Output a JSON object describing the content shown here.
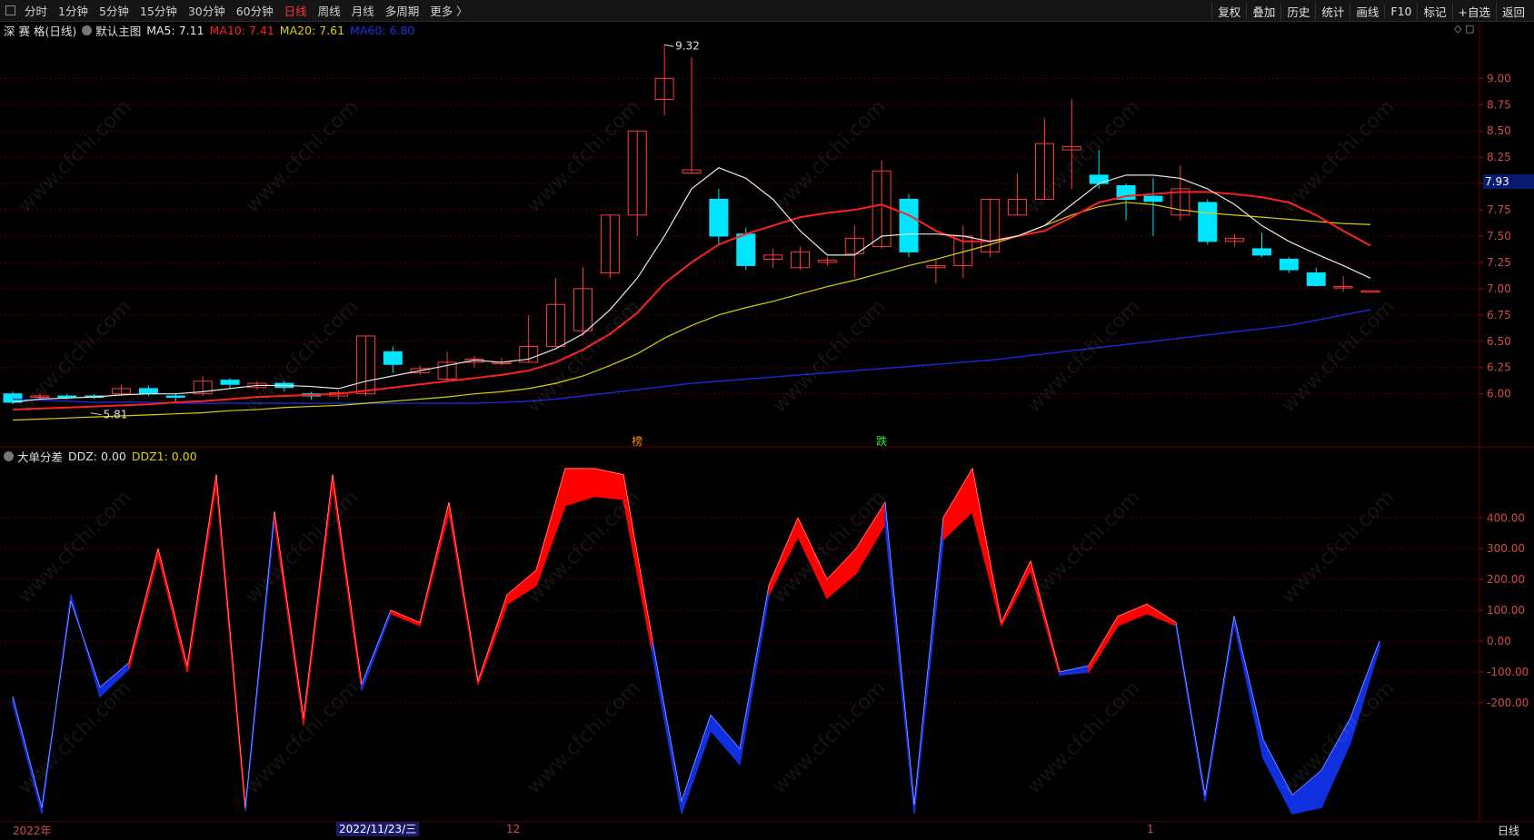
{
  "toolbar": {
    "tabs": [
      "分时",
      "1分钟",
      "5分钟",
      "15分钟",
      "30分钟",
      "60分钟",
      "日线",
      "周线",
      "月线",
      "多周期",
      "更多 〉"
    ],
    "active_tab": "日线",
    "right_buttons": [
      "复权",
      "叠加",
      "历史",
      "统计",
      "画线",
      "F10",
      "标记",
      "+自选",
      "返回"
    ]
  },
  "main_chart": {
    "stock": "深 赛 格(日线)",
    "template": "默认主图",
    "ma5": "MA5: 7.11",
    "ma10": "MA10: 7.41",
    "ma20": "MA20: 7.61",
    "ma60": "MA60: 6.80",
    "high_label": "9.32",
    "low_label": "5.81",
    "current_price": "7.93",
    "y_ticks": [
      "9.00",
      "8.75",
      "8.50",
      "8.25",
      "8.00",
      "7.75",
      "7.50",
      "7.25",
      "7.00",
      "6.75",
      "6.50",
      "6.25",
      "6.00"
    ],
    "markers": [
      "榜",
      "跌"
    ]
  },
  "sub_chart": {
    "indicator": "大单分差",
    "ddz": "DDZ: 0.00",
    "ddz1": "DDZ1: 0.00",
    "y_ticks": [
      "400.00",
      "300.00",
      "200.00",
      "100.00",
      "0.00",
      "-100.00",
      "-200.00"
    ]
  },
  "bottom": {
    "date_labels": [
      "2022年",
      "12",
      "1"
    ],
    "selected_date": "2022/11/23/三",
    "period": "日线"
  },
  "watermark": "www.cfchi.com",
  "colors": {
    "up": "#ff3b3b",
    "down": "#00e5ff",
    "ma5": "#e8e8e8",
    "ma10": "#ff2020",
    "ma20": "#d8d000",
    "ma60": "#1a2ad8",
    "ddz_pos": "#ff0000",
    "ddz_neg": "#1030e0"
  },
  "chart_data": [
    {
      "type": "candlestick",
      "title": "深 赛 格(日线)",
      "ylim": [
        5.6,
        9.4
      ],
      "candles": [
        {
          "o": 6.0,
          "c": 5.92,
          "h": 6.02,
          "l": 5.9
        },
        {
          "o": 5.98,
          "c": 5.98,
          "h": 6.0,
          "l": 5.95
        },
        {
          "o": 5.98,
          "c": 5.97,
          "h": 6.0,
          "l": 5.95
        },
        {
          "o": 5.98,
          "c": 5.97,
          "h": 6.0,
          "l": 5.95
        },
        {
          "o": 6.0,
          "c": 6.05,
          "h": 6.08,
          "l": 5.98
        },
        {
          "o": 6.05,
          "c": 6.0,
          "h": 6.08,
          "l": 5.98
        },
        {
          "o": 5.98,
          "c": 5.97,
          "h": 6.0,
          "l": 5.92
        },
        {
          "o": 6.0,
          "c": 6.12,
          "h": 6.17,
          "l": 5.98
        },
        {
          "o": 6.13,
          "c": 6.09,
          "h": 6.15,
          "l": 6.05
        },
        {
          "o": 6.06,
          "c": 6.1,
          "h": 6.12,
          "l": 6.04
        },
        {
          "o": 6.1,
          "c": 6.06,
          "h": 6.12,
          "l": 6.02
        },
        {
          "o": 6.0,
          "c": 5.98,
          "h": 6.02,
          "l": 5.94
        },
        {
          "o": 5.98,
          "c": 6.01,
          "h": 6.03,
          "l": 5.95
        },
        {
          "o": 6.0,
          "c": 6.55,
          "h": 6.55,
          "l": 5.98
        },
        {
          "o": 6.4,
          "c": 6.28,
          "h": 6.45,
          "l": 6.2
        },
        {
          "o": 6.2,
          "c": 6.24,
          "h": 6.27,
          "l": 6.18
        },
        {
          "o": 6.14,
          "c": 6.3,
          "h": 6.4,
          "l": 6.12
        },
        {
          "o": 6.3,
          "c": 6.33,
          "h": 6.36,
          "l": 6.25
        },
        {
          "o": 6.3,
          "c": 6.3,
          "h": 6.34,
          "l": 6.27
        },
        {
          "o": 6.3,
          "c": 6.45,
          "h": 6.75,
          "l": 6.3
        },
        {
          "o": 6.45,
          "c": 6.85,
          "h": 7.1,
          "l": 6.45
        },
        {
          "o": 6.6,
          "c": 7.0,
          "h": 7.2,
          "l": 6.55
        },
        {
          "o": 7.15,
          "c": 7.7,
          "h": 7.7,
          "l": 7.1
        },
        {
          "o": 7.7,
          "c": 8.5,
          "h": 8.5,
          "l": 7.5
        },
        {
          "o": 8.8,
          "c": 9.0,
          "h": 9.32,
          "l": 8.65
        },
        {
          "o": 8.1,
          "c": 8.13,
          "h": 9.2,
          "l": 8.1
        },
        {
          "o": 7.85,
          "c": 7.5,
          "h": 7.95,
          "l": 7.42
        },
        {
          "o": 7.52,
          "c": 7.22,
          "h": 7.58,
          "l": 7.18
        },
        {
          "o": 7.28,
          "c": 7.32,
          "h": 7.38,
          "l": 7.2
        },
        {
          "o": 7.2,
          "c": 7.35,
          "h": 7.4,
          "l": 7.18
        },
        {
          "o": 7.25,
          "c": 7.27,
          "h": 7.3,
          "l": 7.22
        },
        {
          "o": 7.33,
          "c": 7.48,
          "h": 7.6,
          "l": 7.1
        },
        {
          "o": 7.4,
          "c": 8.12,
          "h": 8.22,
          "l": 7.38
        },
        {
          "o": 7.85,
          "c": 7.35,
          "h": 7.9,
          "l": 7.3
        },
        {
          "o": 7.2,
          "c": 7.22,
          "h": 7.28,
          "l": 7.05
        },
        {
          "o": 7.22,
          "c": 7.5,
          "h": 7.6,
          "l": 7.1
        },
        {
          "o": 7.35,
          "c": 7.85,
          "h": 7.85,
          "l": 7.3
        },
        {
          "o": 7.7,
          "c": 7.85,
          "h": 8.1,
          "l": 7.7
        },
        {
          "o": 7.85,
          "c": 8.38,
          "h": 8.62,
          "l": 7.85
        },
        {
          "o": 8.32,
          "c": 8.35,
          "h": 8.8,
          "l": 7.95
        },
        {
          "o": 8.08,
          "c": 8.0,
          "h": 8.32,
          "l": 7.95
        },
        {
          "o": 7.98,
          "c": 7.85,
          "h": 8.0,
          "l": 7.65
        },
        {
          "o": 7.88,
          "c": 7.83,
          "h": 8.05,
          "l": 7.5
        },
        {
          "o": 7.7,
          "c": 7.95,
          "h": 8.17,
          "l": 7.65
        },
        {
          "o": 7.82,
          "c": 7.45,
          "h": 7.85,
          "l": 7.42
        },
        {
          "o": 7.45,
          "c": 7.48,
          "h": 7.52,
          "l": 7.4
        },
        {
          "o": 7.38,
          "c": 7.32,
          "h": 7.53,
          "l": 7.3
        },
        {
          "o": 7.28,
          "c": 7.18,
          "h": 7.3,
          "l": 7.15
        },
        {
          "o": 7.15,
          "c": 7.03,
          "h": 7.2,
          "l": 7.02
        },
        {
          "o": 7.02,
          "c": 7.02,
          "h": 7.12,
          "l": 6.97
        },
        {
          "o": 6.98,
          "c": 6.98,
          "h": 6.98,
          "l": 6.98
        }
      ],
      "ma5": [
        5.92,
        5.95,
        5.96,
        5.97,
        5.99,
        6.0,
        6.0,
        6.02,
        6.05,
        6.08,
        6.08,
        6.07,
        6.05,
        6.12,
        6.17,
        6.22,
        6.27,
        6.32,
        6.3,
        6.33,
        6.43,
        6.57,
        6.8,
        7.1,
        7.5,
        7.95,
        8.15,
        8.05,
        7.85,
        7.55,
        7.32,
        7.32,
        7.5,
        7.52,
        7.52,
        7.5,
        7.45,
        7.5,
        7.6,
        7.8,
        8.0,
        8.08,
        8.08,
        8.05,
        7.95,
        7.8,
        7.6,
        7.45,
        7.33,
        7.22,
        7.1
      ],
      "ma10": [
        5.85,
        5.86,
        5.87,
        5.88,
        5.89,
        5.9,
        5.92,
        5.93,
        5.95,
        5.97,
        5.98,
        5.99,
        6.0,
        6.03,
        6.06,
        6.09,
        6.12,
        6.15,
        6.18,
        6.22,
        6.3,
        6.42,
        6.57,
        6.77,
        7.05,
        7.25,
        7.42,
        7.52,
        7.6,
        7.68,
        7.72,
        7.75,
        7.8,
        7.7,
        7.55,
        7.45,
        7.45,
        7.5,
        7.55,
        7.68,
        7.82,
        7.88,
        7.9,
        7.92,
        7.92,
        7.9,
        7.87,
        7.82,
        7.7,
        7.55,
        7.41
      ],
      "ma20": [
        5.75,
        5.76,
        5.77,
        5.78,
        5.79,
        5.8,
        5.81,
        5.82,
        5.84,
        5.85,
        5.87,
        5.88,
        5.89,
        5.91,
        5.93,
        5.95,
        5.97,
        6.0,
        6.02,
        6.05,
        6.1,
        6.17,
        6.27,
        6.38,
        6.53,
        6.65,
        6.75,
        6.82,
        6.88,
        6.95,
        7.02,
        7.08,
        7.15,
        7.22,
        7.28,
        7.35,
        7.42,
        7.5,
        7.6,
        7.7,
        7.78,
        7.82,
        7.8,
        7.75,
        7.72,
        7.7,
        7.68,
        7.66,
        7.64,
        7.62,
        7.61
      ],
      "ma60": [
        5.95,
        5.94,
        5.93,
        5.92,
        5.92,
        5.92,
        5.91,
        5.91,
        5.91,
        5.91,
        5.91,
        5.91,
        5.91,
        5.91,
        5.91,
        5.91,
        5.91,
        5.91,
        5.92,
        5.93,
        5.95,
        5.98,
        6.01,
        6.04,
        6.07,
        6.1,
        6.12,
        6.14,
        6.16,
        6.18,
        6.2,
        6.22,
        6.24,
        6.26,
        6.28,
        6.3,
        6.32,
        6.35,
        6.38,
        6.41,
        6.44,
        6.47,
        6.5,
        6.53,
        6.56,
        6.59,
        6.62,
        6.65,
        6.7,
        6.75,
        6.8
      ]
    },
    {
      "type": "area",
      "title": "大单分差",
      "ylim": [
        -560,
        560
      ],
      "ddz": [
        -180,
        -540,
        130,
        -150,
        -70,
        300,
        -80,
        540,
        -540,
        420,
        -250,
        540,
        -140,
        100,
        60,
        450,
        -130,
        150,
        230,
        560,
        560,
        540,
        0,
        -520,
        -240,
        -350,
        180,
        400,
        200,
        300,
        450,
        -530,
        400,
        560,
        60,
        260,
        -100,
        -80,
        80,
        120,
        60,
        -500,
        80,
        -320,
        -500,
        -420,
        -250,
        0
      ],
      "ddz1": [
        -200,
        -560,
        150,
        -180,
        -90,
        280,
        -100,
        510,
        -550,
        390,
        -270,
        510,
        -160,
        90,
        50,
        420,
        -140,
        120,
        180,
        440,
        470,
        460,
        -40,
        -560,
        -290,
        -400,
        150,
        340,
        140,
        220,
        380,
        -560,
        330,
        420,
        50,
        230,
        -110,
        -100,
        50,
        90,
        50,
        -520,
        60,
        -380,
        -560,
        -540,
        -330,
        -20
      ]
    }
  ]
}
